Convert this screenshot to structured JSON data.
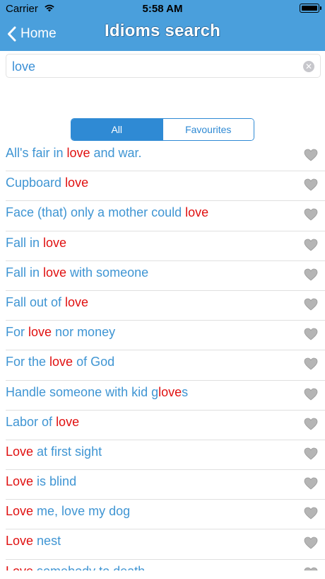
{
  "status": {
    "carrier": "Carrier",
    "time": "5:58 AM",
    "battery_level": 1.0
  },
  "nav": {
    "back_label": "Home",
    "title": "Idioms search"
  },
  "search": {
    "value": "love"
  },
  "segments": [
    {
      "label": "All",
      "selected": true
    },
    {
      "label": "Favourites",
      "selected": false
    }
  ],
  "colors": {
    "header": "#4a9fdc",
    "link": "#3f95d3",
    "highlight": "#e01010",
    "heart": "#b5b5b5"
  },
  "idioms": [
    {
      "parts": [
        "All's fair in ",
        "love",
        " and war."
      ]
    },
    {
      "parts": [
        "Cupboard ",
        "love",
        ""
      ]
    },
    {
      "parts": [
        "Face (that) only a mother could ",
        "love",
        ""
      ]
    },
    {
      "parts": [
        "Fall in ",
        "love",
        ""
      ]
    },
    {
      "parts": [
        "Fall in ",
        "love",
        " with someone"
      ]
    },
    {
      "parts": [
        "Fall out of ",
        "love",
        ""
      ]
    },
    {
      "parts": [
        "For ",
        "love",
        " nor money"
      ]
    },
    {
      "parts": [
        "For the ",
        "love",
        " of God"
      ]
    },
    {
      "parts": [
        "Handle someone with kid g",
        "love",
        "s"
      ]
    },
    {
      "parts": [
        "Labor of ",
        "love",
        ""
      ]
    },
    {
      "parts": [
        "",
        "Love",
        " at first sight"
      ]
    },
    {
      "parts": [
        "",
        "Love",
        " is blind"
      ]
    },
    {
      "parts": [
        "",
        "Love",
        " me, love my dog"
      ]
    },
    {
      "parts": [
        "",
        "Love",
        " nest"
      ]
    },
    {
      "parts": [
        "",
        "Love",
        " somebody to death"
      ]
    }
  ]
}
